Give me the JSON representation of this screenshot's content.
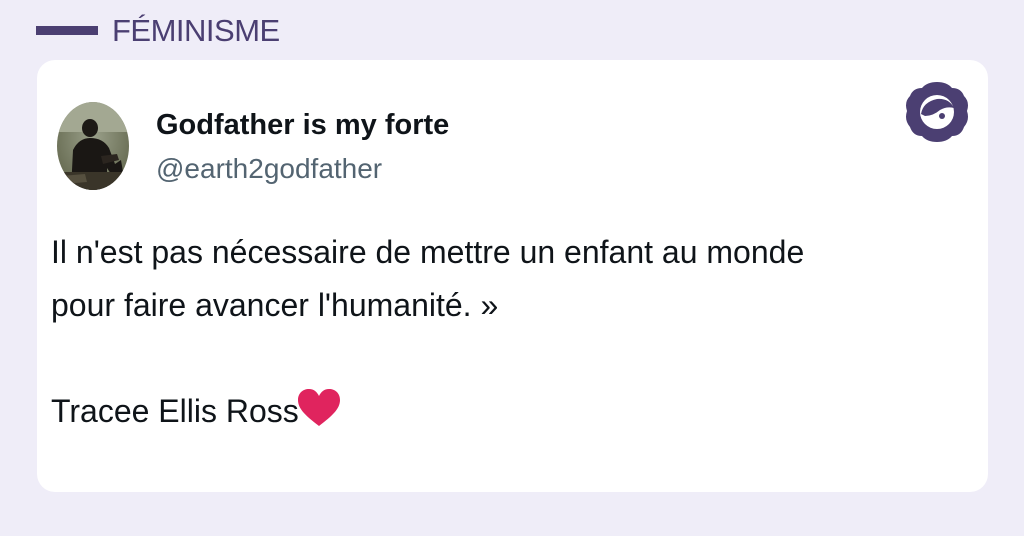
{
  "category": {
    "label": "FÉMINISME",
    "accent_color": "#4b3f72"
  },
  "tweet": {
    "author_name": "Godfather is my forte",
    "author_handle": "@earth2godfather",
    "lines": [
      "Il n'est pas nécessaire de mettre un enfant au monde",
      "pour faire avancer l'humanité. »"
    ],
    "signature": "Tracee Ellis Ross",
    "signature_emoji": "heart-icon",
    "avatar_icon": "profile-photo",
    "brand_icon": "brand-logo-icon"
  },
  "colors": {
    "background": "#efedf8",
    "card": "#ffffff",
    "name_text": "#0f1419",
    "handle_text": "#536471",
    "heart": "#e0245e"
  }
}
